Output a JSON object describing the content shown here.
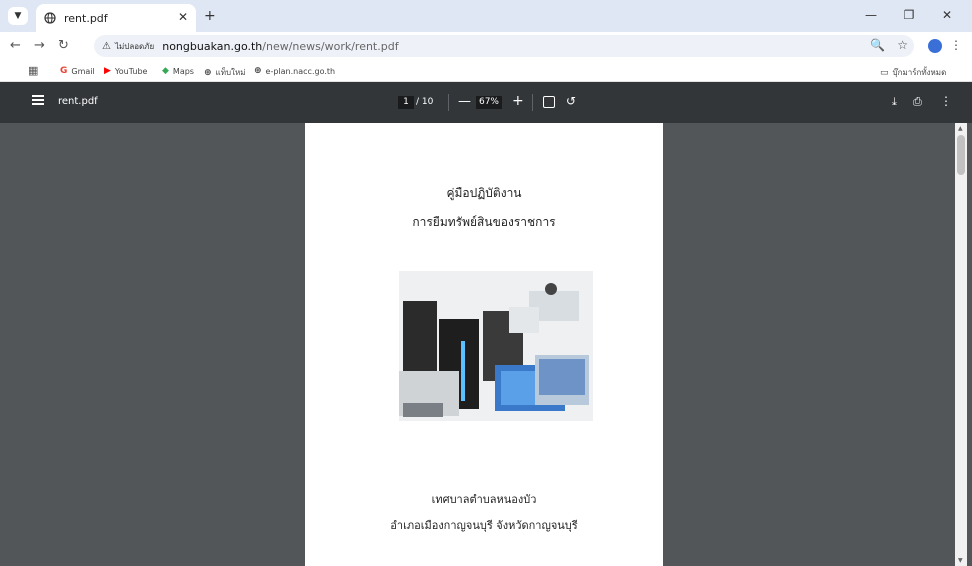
{
  "browser": {
    "tab": {
      "title": "rent.pdf",
      "favicon": "globe-icon"
    },
    "omnibox": {
      "security_label": "ไม่ปลอดภัย",
      "url_host": "nongbuakan.go.th",
      "url_path": "/new/news/work/rent.pdf"
    },
    "bookmarks": [
      {
        "label": "Gmail",
        "icon": "gmail-icon"
      },
      {
        "label": "YouTube",
        "icon": "youtube-icon"
      },
      {
        "label": "Maps",
        "icon": "maps-icon"
      },
      {
        "label": "แท็บใหม่",
        "icon": "globe-icon"
      },
      {
        "label": "e-plan.nacc.go.th",
        "icon": "globe-icon"
      }
    ],
    "bookmarks_folder": "บุ๊กมาร์กทั้งหมด"
  },
  "pdf_toolbar": {
    "title": "rent.pdf",
    "current_page": "1",
    "total_pages": "/ 10",
    "zoom": "67%"
  },
  "document": {
    "title_line1": "คู่มือปฏิบัติงาน",
    "title_line2": "การยืมทรัพย์สินของราชการ",
    "org_line1": "เทศบาลตำบลหนองบัว",
    "org_line2": "อำเภอเมืองกาญจนบุรี    จังหวัดกาญจนบุรี"
  },
  "colors": {
    "tabbar": "#dfe7f4",
    "pdf_toolbar": "#323639",
    "viewer_bg": "#525659",
    "profile_accent": "#3b6fd8"
  }
}
